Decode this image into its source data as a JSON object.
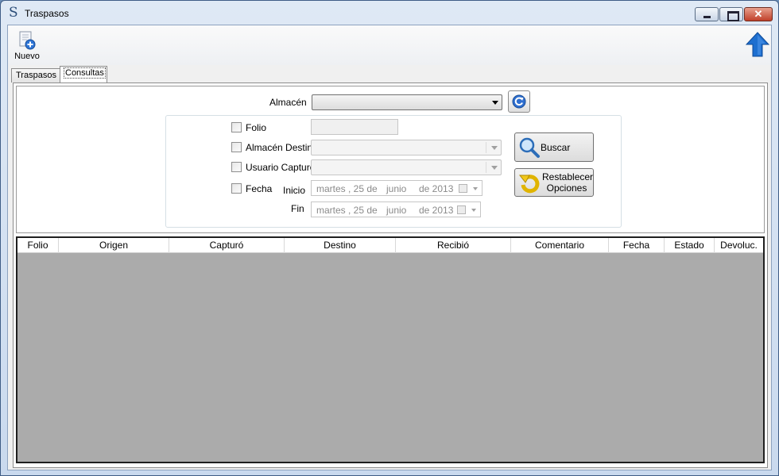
{
  "window": {
    "title": "Traspasos"
  },
  "toolbar": {
    "new_label": "Nuevo"
  },
  "tabs": [
    {
      "label": "Traspasos",
      "selected": false
    },
    {
      "label": "Consultas",
      "selected": true
    }
  ],
  "filters": {
    "almacen_label": "Almacén",
    "almacen_value": "",
    "folio_label": "Folio",
    "folio_value": "",
    "almacen_destino_label": "Almacén Destino",
    "usuario_capturo_label": "Usuario Capturó",
    "fecha_label": "Fecha",
    "inicio_label": "Inicio",
    "fin_label": "Fin",
    "inicio_date": {
      "weekday": "martes",
      "day": ", 25 de",
      "month": "junio",
      "year": "de 2013"
    },
    "fin_date": {
      "weekday": "martes",
      "day": ", 25 de",
      "month": "junio",
      "year": "de 2013"
    }
  },
  "buttons": {
    "buscar_label": "Buscar",
    "restablecer_line1": "Restablecer",
    "restablecer_line2": "Opciones"
  },
  "grid": {
    "columns": [
      "Folio",
      "Origen",
      "Capturó",
      "Destino",
      "Recibió",
      "Comentario",
      "Fecha",
      "Estado",
      "Devoluc."
    ],
    "rows": []
  },
  "colors": {
    "grid_background": "#ababab",
    "accent_blue": "#1e6fd0"
  }
}
